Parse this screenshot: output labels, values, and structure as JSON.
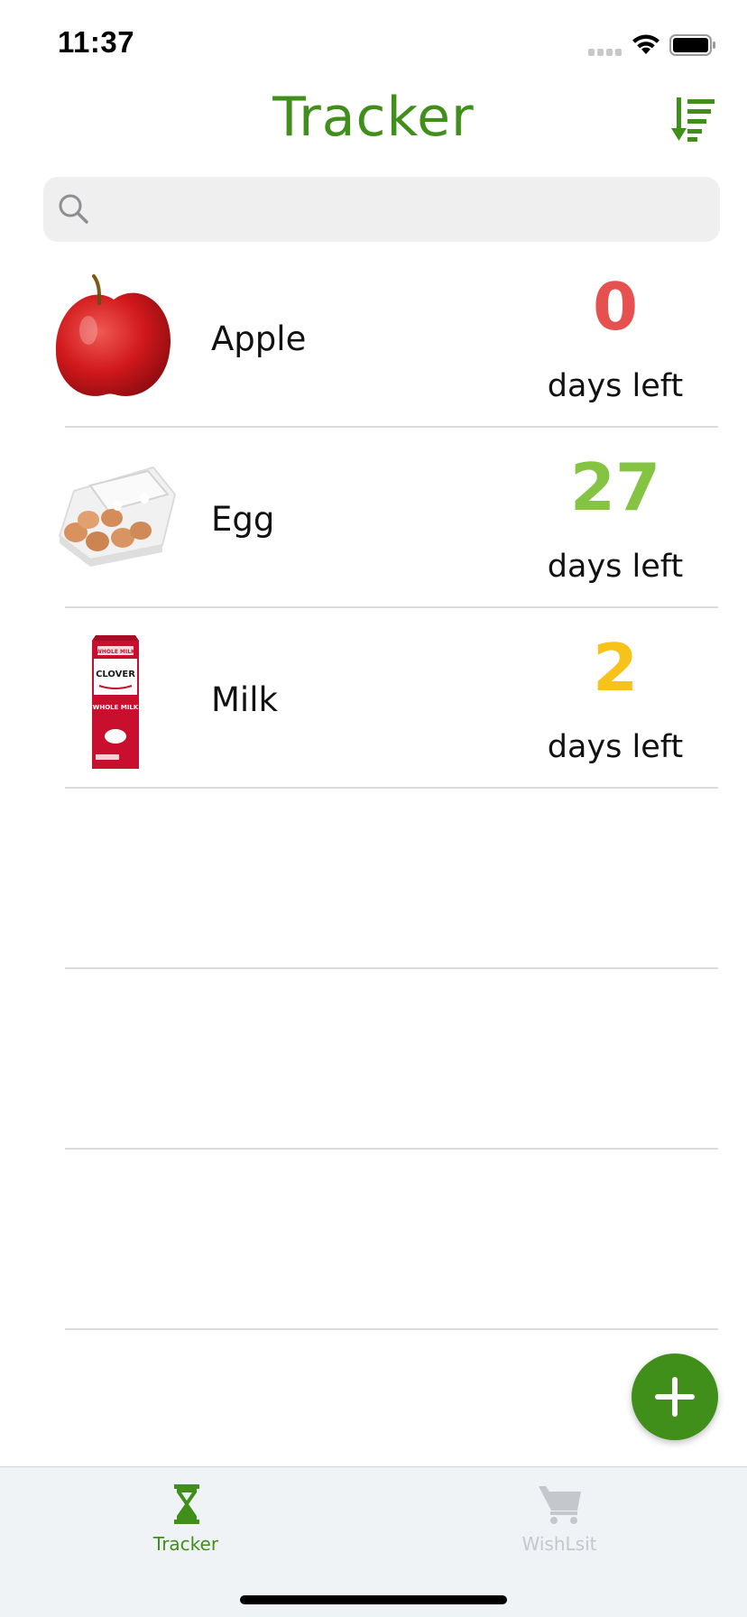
{
  "status_bar": {
    "time": "11:37"
  },
  "header": {
    "title": "Tracker",
    "title_color": "#3f8f1a",
    "sort_icon": "sort-descending-icon"
  },
  "search": {
    "placeholder": "",
    "value": ""
  },
  "items": [
    {
      "name": "Apple",
      "days": "0",
      "unit": "days left",
      "count_color": "#e6504f",
      "image": "apple-image"
    },
    {
      "name": "Egg",
      "days": "27",
      "unit": "days left",
      "count_color": "#85c443",
      "image": "egg-carton-image"
    },
    {
      "name": "Milk",
      "days": "2",
      "unit": "days left",
      "count_color": "#f7c21a",
      "image": "milk-carton-image"
    }
  ],
  "milk_carton_text": {
    "brand": "CLOVER",
    "top": "WHOLE MILK",
    "middle": "WHOLE MILK"
  },
  "fab": {
    "icon": "plus-icon",
    "color": "#3f8f1a"
  },
  "tab_bar": {
    "tabs": [
      {
        "label": "Tracker",
        "icon": "hourglass-icon",
        "active": true,
        "color": "#3f8f1a"
      },
      {
        "label": "WishLsit",
        "icon": "cart-icon",
        "active": false,
        "color": "#c4c7cb"
      }
    ]
  }
}
